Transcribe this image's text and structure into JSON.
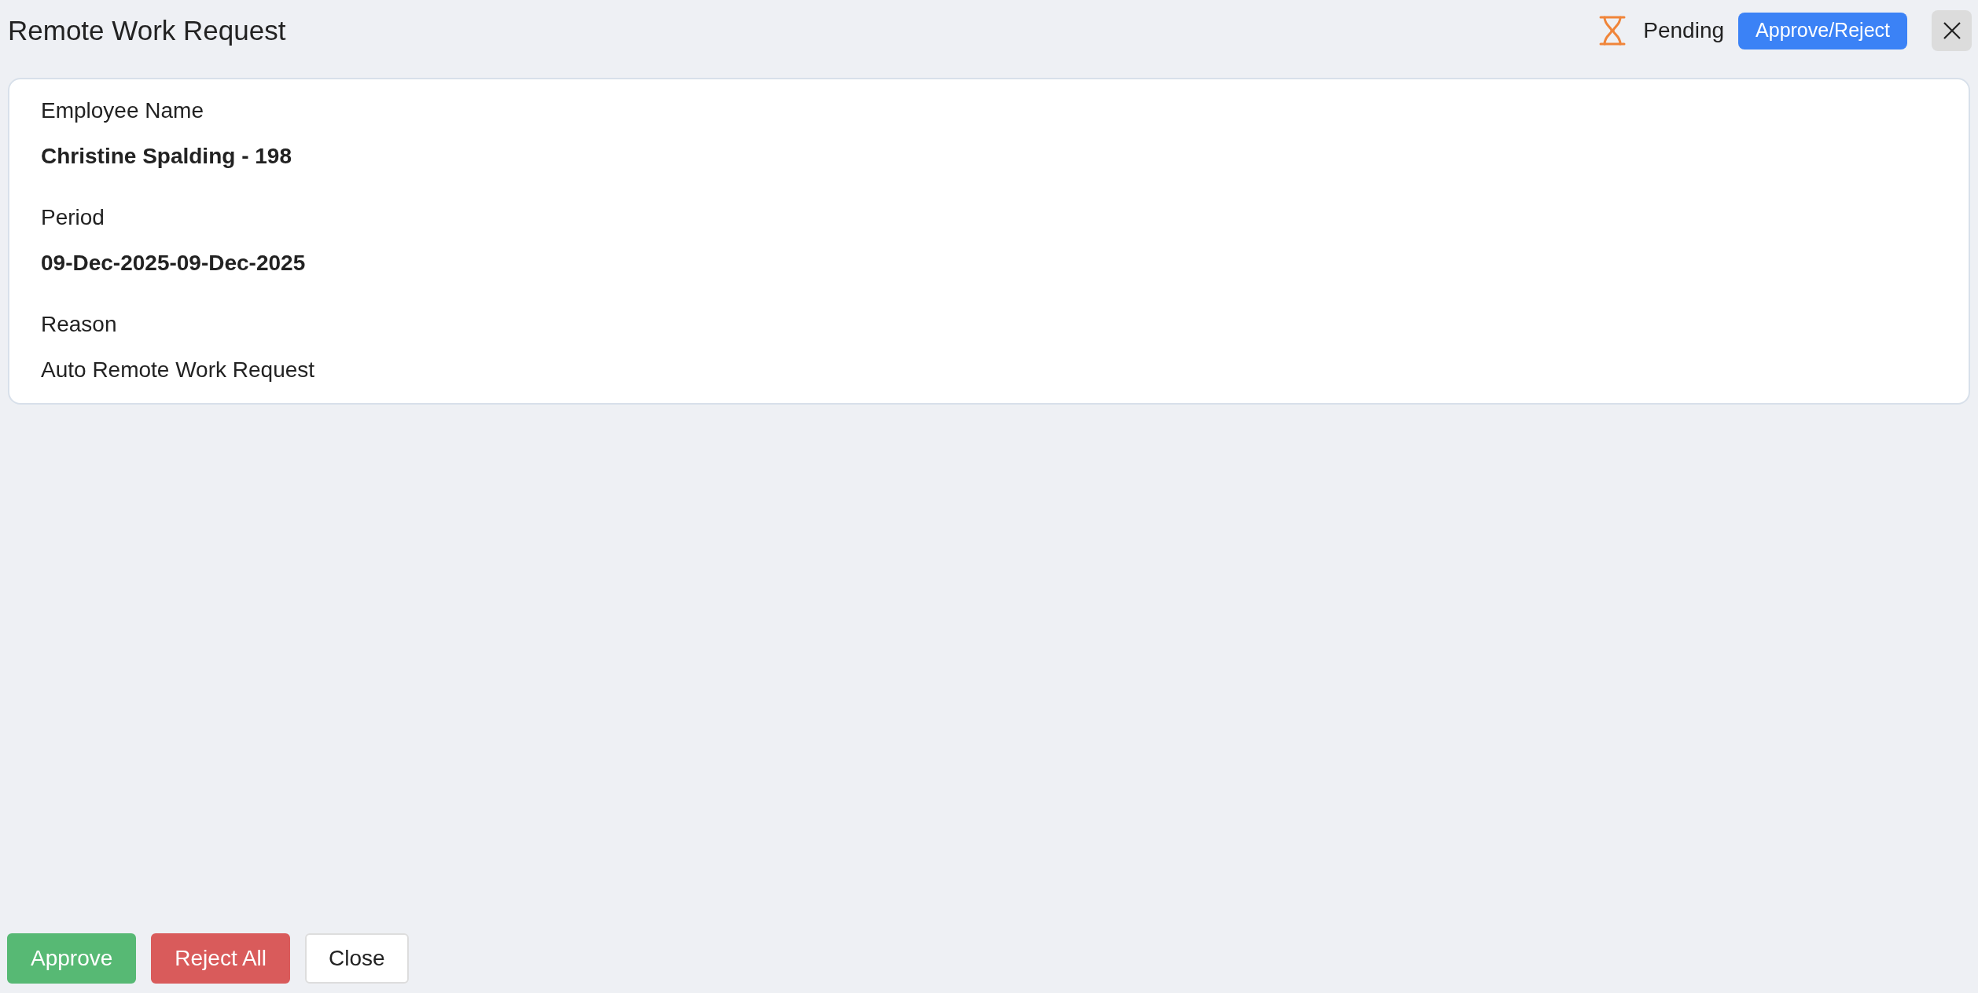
{
  "title": "Remote Work Request",
  "status": {
    "kind": "pending",
    "label": "Pending"
  },
  "header_button": "Approve/Reject",
  "fields": [
    {
      "label": "Employee Name",
      "value": "Christine Spalding - 198",
      "kind": "strong"
    },
    {
      "label": "Period",
      "value": "09-Dec-2025-09-Dec-2025",
      "kind": "strong"
    },
    {
      "label": "Reason",
      "value": "Auto Remote Work Request",
      "kind": "plain"
    }
  ],
  "footer_buttons": [
    {
      "label": "Approve",
      "kind": "approve"
    },
    {
      "label": "Reject All",
      "kind": "reject"
    },
    {
      "label": "Close",
      "kind": "neutral"
    }
  ]
}
